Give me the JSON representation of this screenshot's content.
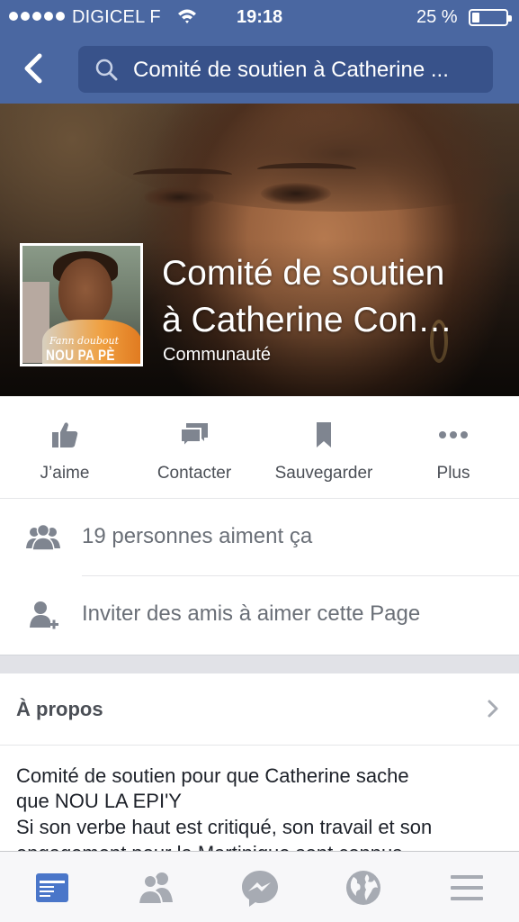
{
  "status_bar": {
    "carrier": "DIGICEL F",
    "time": "19:18",
    "battery_percent": "25 %",
    "battery_level": 0.25,
    "signal_bars": 5
  },
  "nav": {
    "back_icon": "chevron-left-icon",
    "search_icon": "search-icon",
    "search_text": "Comité de soutien à Catherine ..."
  },
  "page": {
    "title_line1": "Comité de soutien",
    "title_line2": "à Catherine Con…",
    "category": "Communauté",
    "avatar_logo_script": "Fann doubout",
    "avatar_logo_text": "NOU PA PÈ"
  },
  "actions": [
    {
      "icon": "thumbs-up-icon",
      "label": "J’aime"
    },
    {
      "icon": "message-icon",
      "label": "Contacter"
    },
    {
      "icon": "bookmark-icon",
      "label": "Sauvegarder"
    },
    {
      "icon": "more-icon",
      "label": "Plus"
    }
  ],
  "rows": {
    "likes": {
      "icon": "people-icon",
      "text": "19 personnes aiment ça"
    },
    "invite": {
      "icon": "add-friend-icon",
      "text": "Inviter des amis à aimer cette Page"
    }
  },
  "about": {
    "title": "À propos",
    "chevron_icon": "chevron-right-icon",
    "lines": [
      "Comité de soutien pour que Catherine sache",
      "que NOU LA EPI'Y",
      "Si son verbe haut est critiqué, son travail et son",
      "engagement pour la Martinique sont connus"
    ]
  },
  "tabbar": {
    "tabs": [
      "news-feed-icon",
      "friends-icon",
      "messenger-icon",
      "globe-icon",
      "menu-icon"
    ],
    "active_color": "#4a76c9",
    "inactive_color": "#a7abb3"
  },
  "colors": {
    "brand_blue": "#4a67a1",
    "search_bg": "#38528a"
  }
}
